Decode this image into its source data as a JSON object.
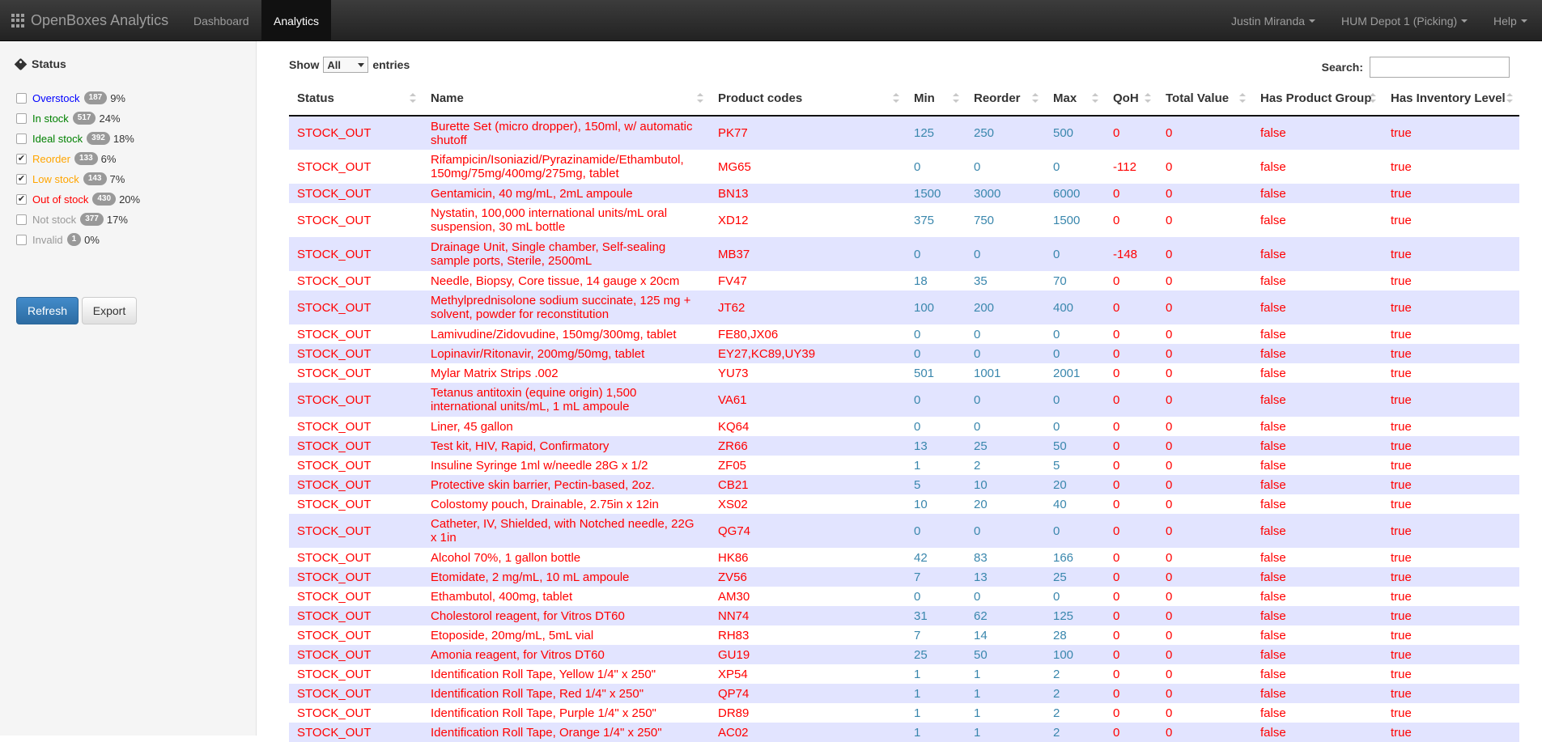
{
  "navbar": {
    "brand": "OpenBoxes Analytics",
    "links": [
      "Dashboard",
      "Analytics"
    ],
    "user": "Justin Miranda",
    "location": "HUM Depot 1 (Picking)",
    "help": "Help"
  },
  "sidebar": {
    "title": "Status",
    "statuses": [
      {
        "label": "Overstock",
        "count": "187",
        "pct": "9%",
        "checked": false,
        "color": "#0000ff"
      },
      {
        "label": "In stock",
        "count": "517",
        "pct": "24%",
        "checked": false,
        "color": "#008000"
      },
      {
        "label": "Ideal stock",
        "count": "392",
        "pct": "18%",
        "checked": false,
        "color": "#008000"
      },
      {
        "label": "Reorder",
        "count": "133",
        "pct": "6%",
        "checked": true,
        "color": "#ffa500"
      },
      {
        "label": "Low stock",
        "count": "143",
        "pct": "7%",
        "checked": true,
        "color": "#ffa500"
      },
      {
        "label": "Out of stock",
        "count": "430",
        "pct": "20%",
        "checked": true,
        "color": "#ff0000"
      },
      {
        "label": "Not stock",
        "count": "377",
        "pct": "17%",
        "checked": false,
        "color": "#999999"
      },
      {
        "label": "Invalid",
        "count": "1",
        "pct": "0%",
        "checked": false,
        "color": "#999999"
      }
    ],
    "refresh_label": "Refresh",
    "export_label": "Export"
  },
  "controls": {
    "show_label": "Show",
    "show_value": "All",
    "entries_label": "entries",
    "search_label": "Search:",
    "search_value": ""
  },
  "table": {
    "headers": [
      "Status",
      "Name",
      "Product codes",
      "Min",
      "Reorder",
      "Max",
      "QoH",
      "Total Value",
      "Has Product Group",
      "Has Inventory Level"
    ],
    "rows": [
      [
        "STOCK_OUT",
        "Burette Set (micro dropper), 150ml, w/ automatic shutoff",
        "PK77",
        "125",
        "250",
        "500",
        "0",
        "0",
        "false",
        "true"
      ],
      [
        "STOCK_OUT",
        "Rifampicin/Isoniazid/Pyrazinamide/Ethambutol, 150mg/75mg/400mg/275mg, tablet",
        "MG65",
        "0",
        "0",
        "0",
        "-112",
        "0",
        "false",
        "true"
      ],
      [
        "STOCK_OUT",
        "Gentamicin, 40 mg/mL, 2mL ampoule",
        "BN13",
        "1500",
        "3000",
        "6000",
        "0",
        "0",
        "false",
        "true"
      ],
      [
        "STOCK_OUT",
        "Nystatin, 100,000 international units/mL oral suspension, 30 mL bottle",
        "XD12",
        "375",
        "750",
        "1500",
        "0",
        "0",
        "false",
        "true"
      ],
      [
        "STOCK_OUT",
        "Drainage Unit, Single chamber, Self-sealing sample ports, Sterile, 2500mL",
        "MB37",
        "0",
        "0",
        "0",
        "-148",
        "0",
        "false",
        "true"
      ],
      [
        "STOCK_OUT",
        "Needle, Biopsy, Core tissue, 14 gauge x 20cm",
        "FV47",
        "18",
        "35",
        "70",
        "0",
        "0",
        "false",
        "true"
      ],
      [
        "STOCK_OUT",
        "Methylprednisolone sodium succinate, 125 mg + solvent, powder for reconstitution",
        "JT62",
        "100",
        "200",
        "400",
        "0",
        "0",
        "false",
        "true"
      ],
      [
        "STOCK_OUT",
        "Lamivudine/Zidovudine, 150mg/300mg, tablet",
        "FE80,JX06",
        "0",
        "0",
        "0",
        "0",
        "0",
        "false",
        "true"
      ],
      [
        "STOCK_OUT",
        "Lopinavir/Ritonavir, 200mg/50mg, tablet",
        "EY27,KC89,UY39",
        "0",
        "0",
        "0",
        "0",
        "0",
        "false",
        "true"
      ],
      [
        "STOCK_OUT",
        "Mylar Matrix Strips .002",
        "YU73",
        "501",
        "1001",
        "2001",
        "0",
        "0",
        "false",
        "true"
      ],
      [
        "STOCK_OUT",
        "Tetanus antitoxin (equine origin) 1,500 international units/mL, 1 mL ampoule",
        "VA61",
        "0",
        "0",
        "0",
        "0",
        "0",
        "false",
        "true"
      ],
      [
        "STOCK_OUT",
        "Liner, 45 gallon",
        "KQ64",
        "0",
        "0",
        "0",
        "0",
        "0",
        "false",
        "true"
      ],
      [
        "STOCK_OUT",
        "Test kit, HIV, Rapid, Confirmatory",
        "ZR66",
        "13",
        "25",
        "50",
        "0",
        "0",
        "false",
        "true"
      ],
      [
        "STOCK_OUT",
        "Insuline Syringe 1ml w/needle 28G x 1/2",
        "ZF05",
        "1",
        "2",
        "5",
        "0",
        "0",
        "false",
        "true"
      ],
      [
        "STOCK_OUT",
        "Protective skin barrier, Pectin-based, 2oz.",
        "CB21",
        "5",
        "10",
        "20",
        "0",
        "0",
        "false",
        "true"
      ],
      [
        "STOCK_OUT",
        "Colostomy pouch, Drainable, 2.75in x 12in",
        "XS02",
        "10",
        "20",
        "40",
        "0",
        "0",
        "false",
        "true"
      ],
      [
        "STOCK_OUT",
        "Catheter, IV, Shielded, with Notched needle, 22G x 1in",
        "QG74",
        "0",
        "0",
        "0",
        "0",
        "0",
        "false",
        "true"
      ],
      [
        "STOCK_OUT",
        "Alcohol 70%, 1 gallon bottle",
        "HK86",
        "42",
        "83",
        "166",
        "0",
        "0",
        "false",
        "true"
      ],
      [
        "STOCK_OUT",
        "Etomidate, 2 mg/mL, 10 mL ampoule",
        "ZV56",
        "7",
        "13",
        "25",
        "0",
        "0",
        "false",
        "true"
      ],
      [
        "STOCK_OUT",
        "Ethambutol, 400mg, tablet",
        "AM30",
        "0",
        "0",
        "0",
        "0",
        "0",
        "false",
        "true"
      ],
      [
        "STOCK_OUT",
        "Cholestorol reagent, for Vitros DT60",
        "NN74",
        "31",
        "62",
        "125",
        "0",
        "0",
        "false",
        "true"
      ],
      [
        "STOCK_OUT",
        "Etoposide, 20mg/mL, 5mL vial",
        "RH83",
        "7",
        "14",
        "28",
        "0",
        "0",
        "false",
        "true"
      ],
      [
        "STOCK_OUT",
        "Amonia reagent, for Vitros DT60",
        "GU19",
        "25",
        "50",
        "100",
        "0",
        "0",
        "false",
        "true"
      ],
      [
        "STOCK_OUT",
        "Identification Roll Tape, Yellow 1/4\" x 250\"",
        "XP54",
        "1",
        "1",
        "2",
        "0",
        "0",
        "false",
        "true"
      ],
      [
        "STOCK_OUT",
        "Identification Roll Tape, Red 1/4\" x 250\"",
        "QP74",
        "1",
        "1",
        "2",
        "0",
        "0",
        "false",
        "true"
      ],
      [
        "STOCK_OUT",
        "Identification Roll Tape, Purple 1/4\" x 250\"",
        "DR89",
        "1",
        "1",
        "2",
        "0",
        "0",
        "false",
        "true"
      ],
      [
        "STOCK_OUT",
        "Identification Roll Tape, Orange 1/4\" x 250\"",
        "AC02",
        "1",
        "1",
        "2",
        "0",
        "0",
        "false",
        "true"
      ]
    ]
  }
}
